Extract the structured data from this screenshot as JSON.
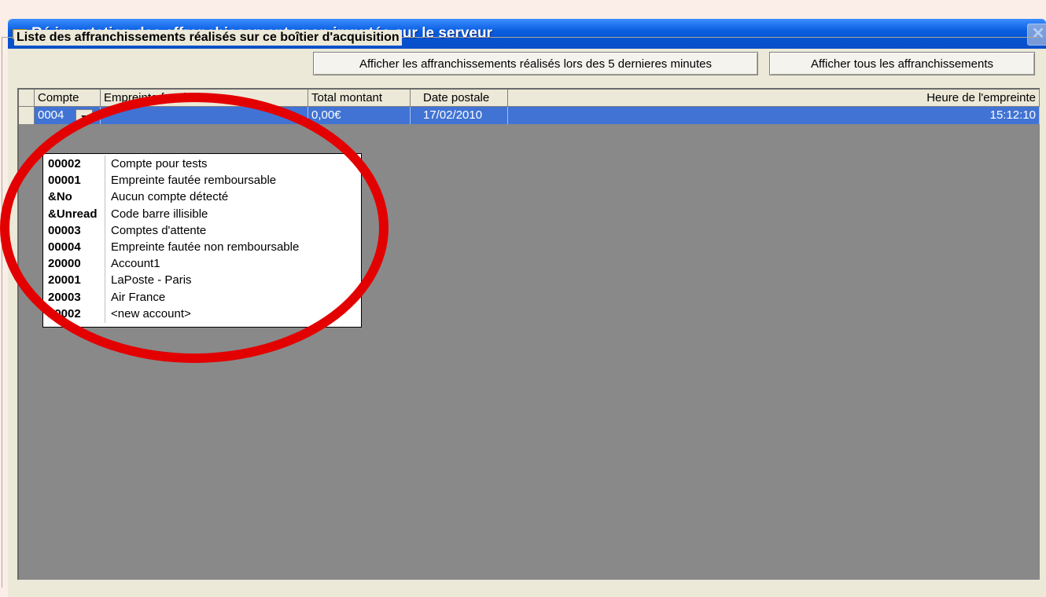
{
  "window": {
    "title": "Ré imputation des affranchissements non imputés sur le serveur",
    "close_label": "✕"
  },
  "group": {
    "label": "Liste des affranchissements réalisés sur ce boîtier d'acquisition"
  },
  "buttons": {
    "recent": "Afficher les affranchissements réalisés lors des 5 dernieres minutes",
    "all": "Afficher tous les affranchissements"
  },
  "grid": {
    "headers": [
      "Compte",
      "Empreinte fautée",
      "Total montant",
      "Date postale",
      "Heure de l'empreinte"
    ],
    "row": {
      "compte": "0004",
      "empreinte": "-",
      "montant": "0,00€",
      "date": "17/02/2010",
      "heure": "15:12:10"
    }
  },
  "accounts": [
    {
      "code": "00002",
      "name": "Compte pour tests"
    },
    {
      "code": "00001",
      "name": "Empreinte fautée remboursable"
    },
    {
      "code": "&No",
      "name": "Aucun compte détecté"
    },
    {
      "code": "&Unread",
      "name": "Code barre illisible"
    },
    {
      "code": "00003",
      "name": "Comptes d'attente"
    },
    {
      "code": "00004",
      "name": "Empreinte fautée non remboursable"
    },
    {
      "code": "20000",
      "name": "Account1"
    },
    {
      "code": "20001",
      "name": "LaPoste - Paris"
    },
    {
      "code": "20003",
      "name": "Air France"
    },
    {
      "code": "20002",
      "name": "<new account>"
    }
  ],
  "colors": {
    "annotation": "#e30000",
    "selection": "#4073d4",
    "titlebar": "#0a5fe0"
  }
}
